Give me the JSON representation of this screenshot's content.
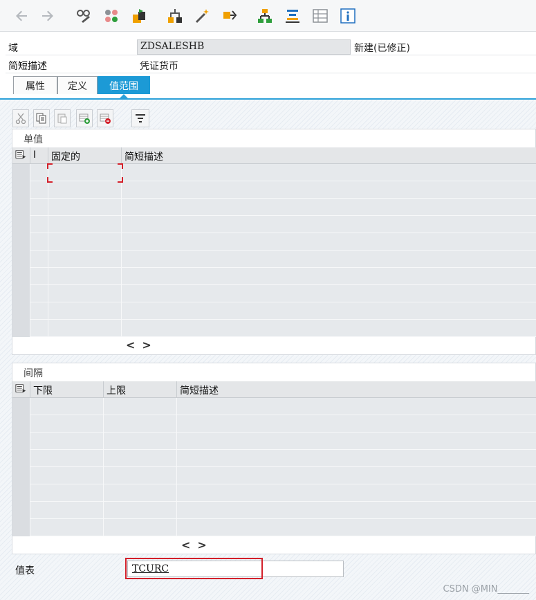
{
  "toolbar": {
    "buttons": [
      {
        "name": "back-arrow-icon"
      },
      {
        "name": "forward-arrow-icon"
      },
      {
        "name": "display-change-icon"
      },
      {
        "name": "check-icon"
      },
      {
        "name": "activate-icon"
      },
      {
        "name": "where-used-icon"
      },
      {
        "name": "magic-wand-icon"
      },
      {
        "name": "navigate-object-icon"
      },
      {
        "name": "hierarchy-icon"
      },
      {
        "name": "layout-icon"
      },
      {
        "name": "table-view-icon"
      },
      {
        "name": "info-icon"
      }
    ],
    "colors": {
      "orange": "#f0a000",
      "green": "#2e9e3c",
      "blue": "#1f6fbf",
      "gray": "#8c9196"
    }
  },
  "header": {
    "domain_label": "域",
    "domain_value": "ZDSALESHB",
    "domain_status": "新建(已修正)",
    "short_desc_label": "简短描述",
    "short_desc_value": "凭证货币"
  },
  "tabs": [
    {
      "label": "属性",
      "active": false
    },
    {
      "label": "定义",
      "active": false
    },
    {
      "label": "值范围",
      "active": true
    }
  ],
  "single_values": {
    "title": "单值",
    "columns": [
      "I",
      "固定的",
      "简短描述"
    ],
    "rows": [
      [
        "",
        "",
        ""
      ],
      [
        "",
        "",
        ""
      ],
      [
        "",
        "",
        ""
      ],
      [
        "",
        "",
        ""
      ],
      [
        "",
        "",
        ""
      ],
      [
        "",
        "",
        ""
      ],
      [
        "",
        "",
        ""
      ],
      [
        "",
        "",
        ""
      ],
      [
        "",
        "",
        ""
      ],
      [
        "",
        "",
        ""
      ]
    ]
  },
  "intervals": {
    "title": "间隔",
    "columns": [
      "下限",
      "上限",
      "简短描述"
    ],
    "rows": [
      [
        "",
        "",
        ""
      ],
      [
        "",
        "",
        ""
      ],
      [
        "",
        "",
        ""
      ],
      [
        "",
        "",
        ""
      ],
      [
        "",
        "",
        ""
      ],
      [
        "",
        "",
        ""
      ],
      [
        "",
        "",
        ""
      ],
      [
        "",
        "",
        ""
      ]
    ]
  },
  "nav": {
    "left": "<",
    "right": ">"
  },
  "value_table": {
    "label": "值表",
    "value": "TCURC"
  },
  "watermark": "CSDN @MIN_______",
  "accent": "#1c9ad6",
  "highlight": "#d3202a"
}
